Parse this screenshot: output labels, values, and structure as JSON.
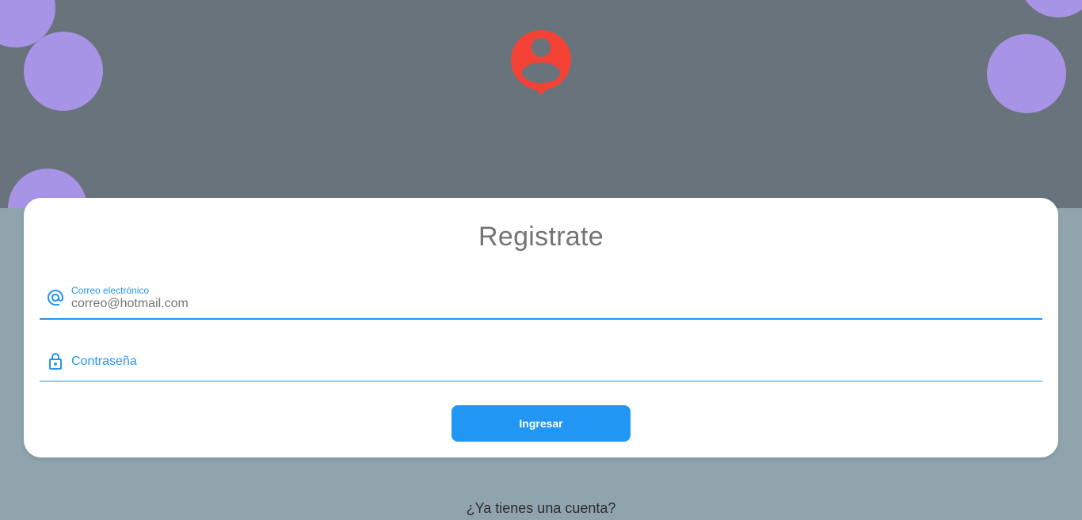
{
  "header": {
    "logo_icon": "user-location-pin-icon",
    "colors": {
      "band": "#69737b",
      "bubbles": "#a894e6",
      "logo": "#f44336"
    }
  },
  "card": {
    "title": "Registrate",
    "email": {
      "icon": "at-sign-icon",
      "label": "Correo electrónico",
      "value": "correo@hotmail.com"
    },
    "password": {
      "icon": "lock-icon",
      "label": "Contraseña"
    },
    "submit_label": "Ingresar",
    "accent": "#2196f3"
  },
  "footer": {
    "account_prompt": "¿Ya tienes una cuenta?"
  }
}
